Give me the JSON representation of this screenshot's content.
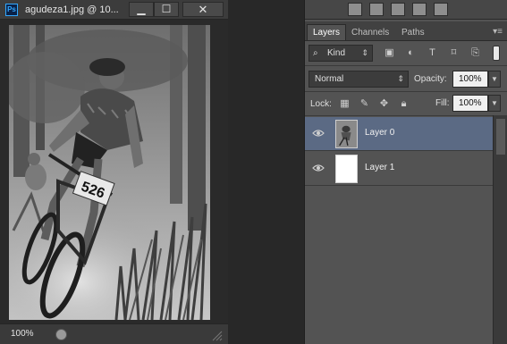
{
  "document": {
    "app_badge": "Ps",
    "title": "agudeza1.jpg @ 10...",
    "minimize_symbol": "▁",
    "maximize_symbol": "☐",
    "close_symbol": "✕",
    "zoom_level": "100%",
    "photo": {
      "bib_number": "526"
    }
  },
  "panel": {
    "tabs": [
      {
        "label": "Layers",
        "active": true
      },
      {
        "label": "Channels",
        "active": false
      },
      {
        "label": "Paths",
        "active": false
      }
    ],
    "menu_symbol": "▾≡",
    "filter_kind": "Kind",
    "filter_icons": [
      "image-filter-icon",
      "adjustment-filter-icon",
      "type-filter-icon",
      "shape-filter-icon",
      "smart-object-filter-icon"
    ],
    "blend_mode": "Normal",
    "opacity_label": "Opacity:",
    "opacity_value": "100%",
    "lock_label": "Lock:",
    "fill_label": "Fill:",
    "fill_value": "100%",
    "layers": [
      {
        "name": "Layer 0",
        "selected": true,
        "visible": true
      },
      {
        "name": "Layer 1",
        "selected": false,
        "visible": true
      }
    ]
  },
  "colors": {
    "selected_layer": "#5b6a84",
    "panel_bg": "#535353",
    "ps_accent": "#31a8ff"
  }
}
